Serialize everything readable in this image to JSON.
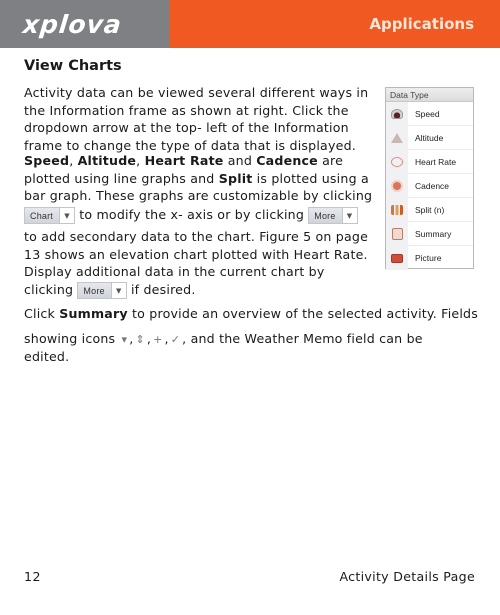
{
  "header": {
    "brand": "xplova",
    "section": "Applications",
    "colors": {
      "brand_bg": "#7f8083",
      "section_bg": "#f05a22"
    }
  },
  "title": "View Charts",
  "p1": "Activity data can be viewed several different ways in the Information frame as shown at right. Click the dropdown arrow at the top- left of the Information frame to change the type of data that is displayed.",
  "p2": {
    "b1": "Speed",
    "s1": ", ",
    "b2": "Altitude",
    "s2": ", ",
    "b3": "Heart Rate",
    "s3": " and ",
    "b4": "Cadence",
    "s4": " are plotted using line graphs and ",
    "b5": "Split",
    "s5": " is plotted using a bar graph. These graphs are customizable by clicking"
  },
  "line_chart": {
    "chart_btn": "Chart",
    "text": " to modify the x- axis or by clicking ",
    "more_btn": "More"
  },
  "p2b": "to add secondary data to the chart. Figure 5 on page 13 shows an elevation chart plotted with Heart Rate. Display additional data in the current chart by",
  "line_clicking": {
    "pre": "clicking ",
    "more_btn": "More",
    "post": " if desired."
  },
  "p3": {
    "pre": "Click ",
    "bold": "Summary",
    "post": " to provide an overview of the selected activity. Fields"
  },
  "line_icons": {
    "pre": "showing icons ",
    "icons": [
      "dropdown-arrow",
      "up-down-arrows",
      "plus",
      "checkmark"
    ],
    "glyphs": [
      "▾",
      "⇕",
      "+",
      "✓"
    ],
    "sep": " , ",
    "post": ", and the Weather Memo field can be"
  },
  "line_edited": "edited.",
  "panel": {
    "header": "Data Type",
    "items": [
      {
        "label": "Speed",
        "icon": "speed-icon"
      },
      {
        "label": "Altitude",
        "icon": "altitude-icon"
      },
      {
        "label": "Heart Rate",
        "icon": "heart-rate-icon"
      },
      {
        "label": "Cadence",
        "icon": "cadence-icon"
      },
      {
        "label": "Split (n)",
        "icon": "split-icon"
      },
      {
        "label": "Summary",
        "icon": "summary-icon"
      },
      {
        "label": "Picture",
        "icon": "picture-icon"
      }
    ]
  },
  "footer": {
    "page_number": "12",
    "section": "Activity Details Page"
  }
}
